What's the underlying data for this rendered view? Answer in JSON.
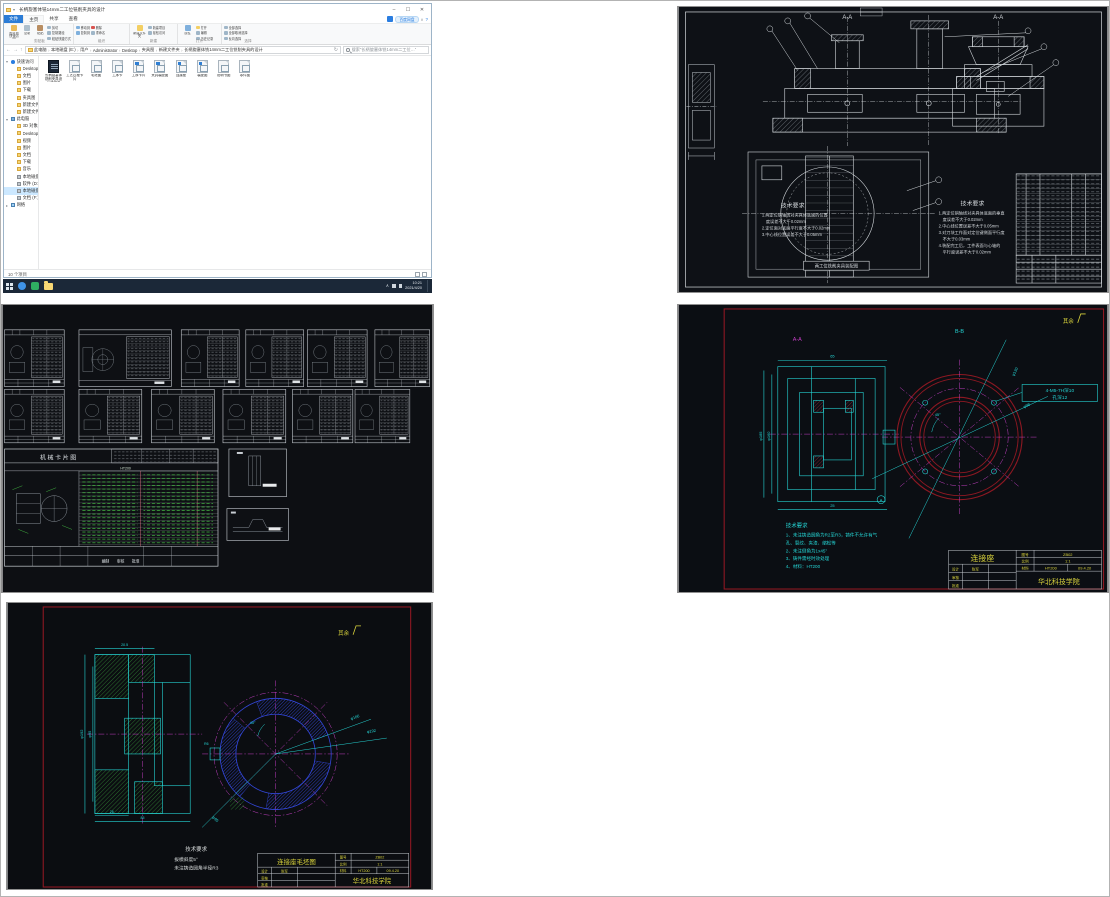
{
  "explorer": {
    "title": "长柄旋塞体铣14mm二工位铣削夹具的设计",
    "window_controls": {
      "minimize": "–",
      "maximize": "☐",
      "close": "✕"
    },
    "tabs": {
      "file": "文件",
      "home": "主页",
      "share": "共享",
      "view": "查看"
    },
    "baidu": "百度网盘",
    "collapse": "∨",
    "help": "?",
    "ribbon": {
      "pin": "固定到快速访问",
      "copy": "复制",
      "paste": "粘贴",
      "cut": "剪切",
      "copy_path": "复制路径",
      "paste_shortcut": "粘贴快捷方式",
      "move_to": "移动到",
      "copy_to": "复制到",
      "delete": "删除",
      "rename": "重命名",
      "new_folder": "新建文件夹",
      "new_item": "新建项目",
      "easy_access": "轻松访问",
      "properties": "属性",
      "open": "打开",
      "edit": "编辑",
      "history": "历史记录",
      "select_all": "全部选择",
      "select_none": "全部取消选择",
      "invert_selection": "反向选择",
      "group_clipboard": "剪贴板",
      "group_organize": "组织",
      "group_new": "新建",
      "group_open": "打开",
      "group_select": "选择"
    },
    "nav": {
      "back": "←",
      "fwd": "→",
      "drop": "▾",
      "up": "↑",
      "refresh": "↻"
    },
    "crumb_sep": "›",
    "breadcrumb": [
      "此电脑",
      "本地磁盘 (E:)",
      "用户",
      "Administrator",
      "Desktop",
      "夹具图",
      "新建文件夹",
      "长柄旋塞体铣14mm二工位铣削夹具的设计"
    ],
    "search": "搜索\"长柄旋塞体铣14mm二工位…\"",
    "sidebar": {
      "exp_open": "▾",
      "exp_closed": "▸",
      "quick_access": "快速访问",
      "quick_items": [
        "Desktop",
        "文档",
        "图片",
        "下载",
        "夹具图",
        "新建文件夹",
        "新建文件夹 (2)"
      ],
      "this_pc": "此电脑",
      "pc_items": [
        "3D 对象",
        "Desktop",
        "视频",
        "图片",
        "文档",
        "下载",
        "音乐",
        "本地磁盘 (C:)",
        "软件 (D:)",
        "本地磁盘 (E:)",
        "文档 (F:)"
      ],
      "network": "网络"
    },
    "files": [
      {
        "name": "长柄旋塞体铣削夹具设计说明书"
      },
      {
        "name": "工艺过程卡片"
      },
      {
        "name": "毛坯图"
      },
      {
        "name": "工序卡"
      },
      {
        "name": "工序卡片"
      },
      {
        "name": "夹具装配图"
      },
      {
        "name": "连接座"
      },
      {
        "name": "装配图"
      },
      {
        "name": "说明书图"
      },
      {
        "name": "零件图"
      }
    ],
    "status": "10 个项目",
    "taskbar_time": "10:21",
    "taskbar_date": "2021/4/20"
  },
  "assembly": {
    "label_aa_left": "A-A",
    "label_aa_right": "A-A",
    "tech_title_left": "技术要求",
    "tech_left": [
      "1.两定位销轴线对夹具体底面的位置",
      "度误差不大于0.02mm",
      "2.定位面对底面平行度不大于0.02mm",
      "3.中心线位置误差不大于0.05mm"
    ],
    "tech_title_right": "技术要求",
    "tech_right": [
      "1.两定位销轴线对夹具体底面的垂直",
      "度误差不大于0.02mm",
      "2.中心线位置误差不大于0.05mm",
      "3.对刀块工作面对定位键侧面平行度",
      "不大于0.03mm",
      "4.装配完工后，工件表面与心轴的",
      "平行度误差不大于0.02mm"
    ],
    "caption": "两工位铣削夹具装配图"
  },
  "model_space": {
    "card_title": "机 械 卡 片 图",
    "card_material": "HT200",
    "card_footer": "编制　　审核　　批准"
  },
  "part": {
    "surface_note": "其余",
    "label_aa": "A-A",
    "label_bb": "B-B",
    "callout1": "4-M5-7H深10",
    "callout2": "孔深12",
    "detail_mark": "A",
    "angle": "45°",
    "dims": [
      "φ185",
      "φ160",
      "φ130",
      "φ98",
      "65",
      "25"
    ],
    "tech": [
      "技术要求",
      "1、未注铸造圆角为R2至R3，铸件不允许有气",
      "孔、裂纹、夹渣、缩松等",
      "2、未注倒角为1x45°",
      "3、铸件需经时效处理",
      "4、材料：HT200"
    ],
    "tb": {
      "name": "连接座",
      "no_label": "图号",
      "no": "ZB02",
      "scale_label": "比例",
      "scale": "1:1",
      "design": "设计",
      "designer": "陈军",
      "check": "审核",
      "approve": "批准",
      "material_label": "材料",
      "material": "HT200",
      "date": "09.4.20",
      "org": "华北科技学院"
    }
  },
  "blank": {
    "surface_note": "其余",
    "angle": "45°",
    "dims": [
      "φ192",
      "φ166",
      "φ95",
      "20.5",
      "26",
      "85",
      "R6"
    ],
    "tech": [
      "技术要求",
      "拔模斜度5°",
      "未注铸造圆角半径R3"
    ],
    "tb": {
      "name": "连接座毛坯图",
      "no_label": "图号",
      "no": "ZB02",
      "scale_label": "比例",
      "scale": "1:1",
      "design": "设计",
      "designer": "陈军",
      "check": "审核",
      "approve": "批准",
      "material_label": "材料",
      "material": "HT200",
      "date": "09.4.20",
      "org": "华北科技学院"
    }
  },
  "colors": {
    "cad_bg": "#0d0f14",
    "cad_white": "#d4d9dd",
    "cad_cyan": "#25d6d6",
    "cad_magenta": "#c43ec4",
    "cad_dark_red": "#8e1822",
    "cad_yellow": "#d8d23c",
    "cad_green": "#3fae3f",
    "cad_blue": "#3347d9",
    "taskbar": "#1b2838",
    "accent_blue": "#2b7cd6"
  }
}
